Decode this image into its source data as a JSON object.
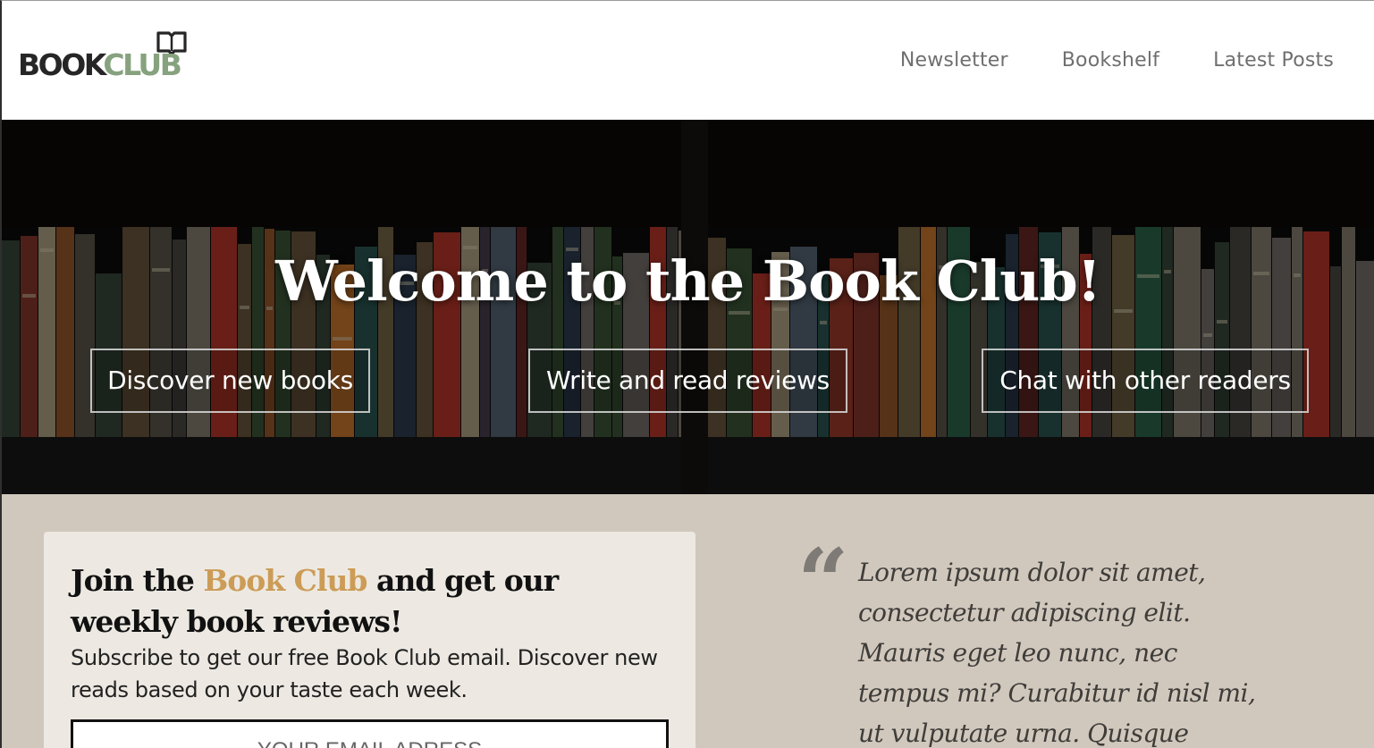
{
  "header": {
    "logo": {
      "part1": "BOOK",
      "part2": "CLUB"
    },
    "nav": [
      {
        "label": "Newsletter"
      },
      {
        "label": "Bookshelf"
      },
      {
        "label": "Latest Posts"
      }
    ]
  },
  "hero": {
    "title": "Welcome to the Book Club!",
    "buttons": [
      {
        "label": "Discover new books"
      },
      {
        "label": "Write and read reviews"
      },
      {
        "label": "Chat with other readers"
      }
    ]
  },
  "signup": {
    "heading_pre": "Join the ",
    "heading_accent": "Book Club",
    "heading_post": " and get our weekly book reviews!",
    "description": "Subscribe to get our free Book Club email. Discover new reads based on your taste each week.",
    "email_placeholder": "YOUR EMAIL ADRESS"
  },
  "quote": {
    "mark": "“",
    "text": "Lorem ipsum dolor sit amet, consectetur adipiscing elit. Mauris eget leo nunc, nec tempus mi? Curabitur id nisl mi, ut vulputate urna. Quisque"
  },
  "colors": {
    "logo_dark": "#262626",
    "logo_accent": "#86a27e",
    "nav_text": "#6f6f6f",
    "accent_gold": "#cc9c57",
    "section_bg": "#d1c8bd",
    "card_bg": "#ede9e2"
  },
  "icons": {
    "logo_icon": "open-book-icon",
    "hero_background": "bookshelf-photo"
  }
}
